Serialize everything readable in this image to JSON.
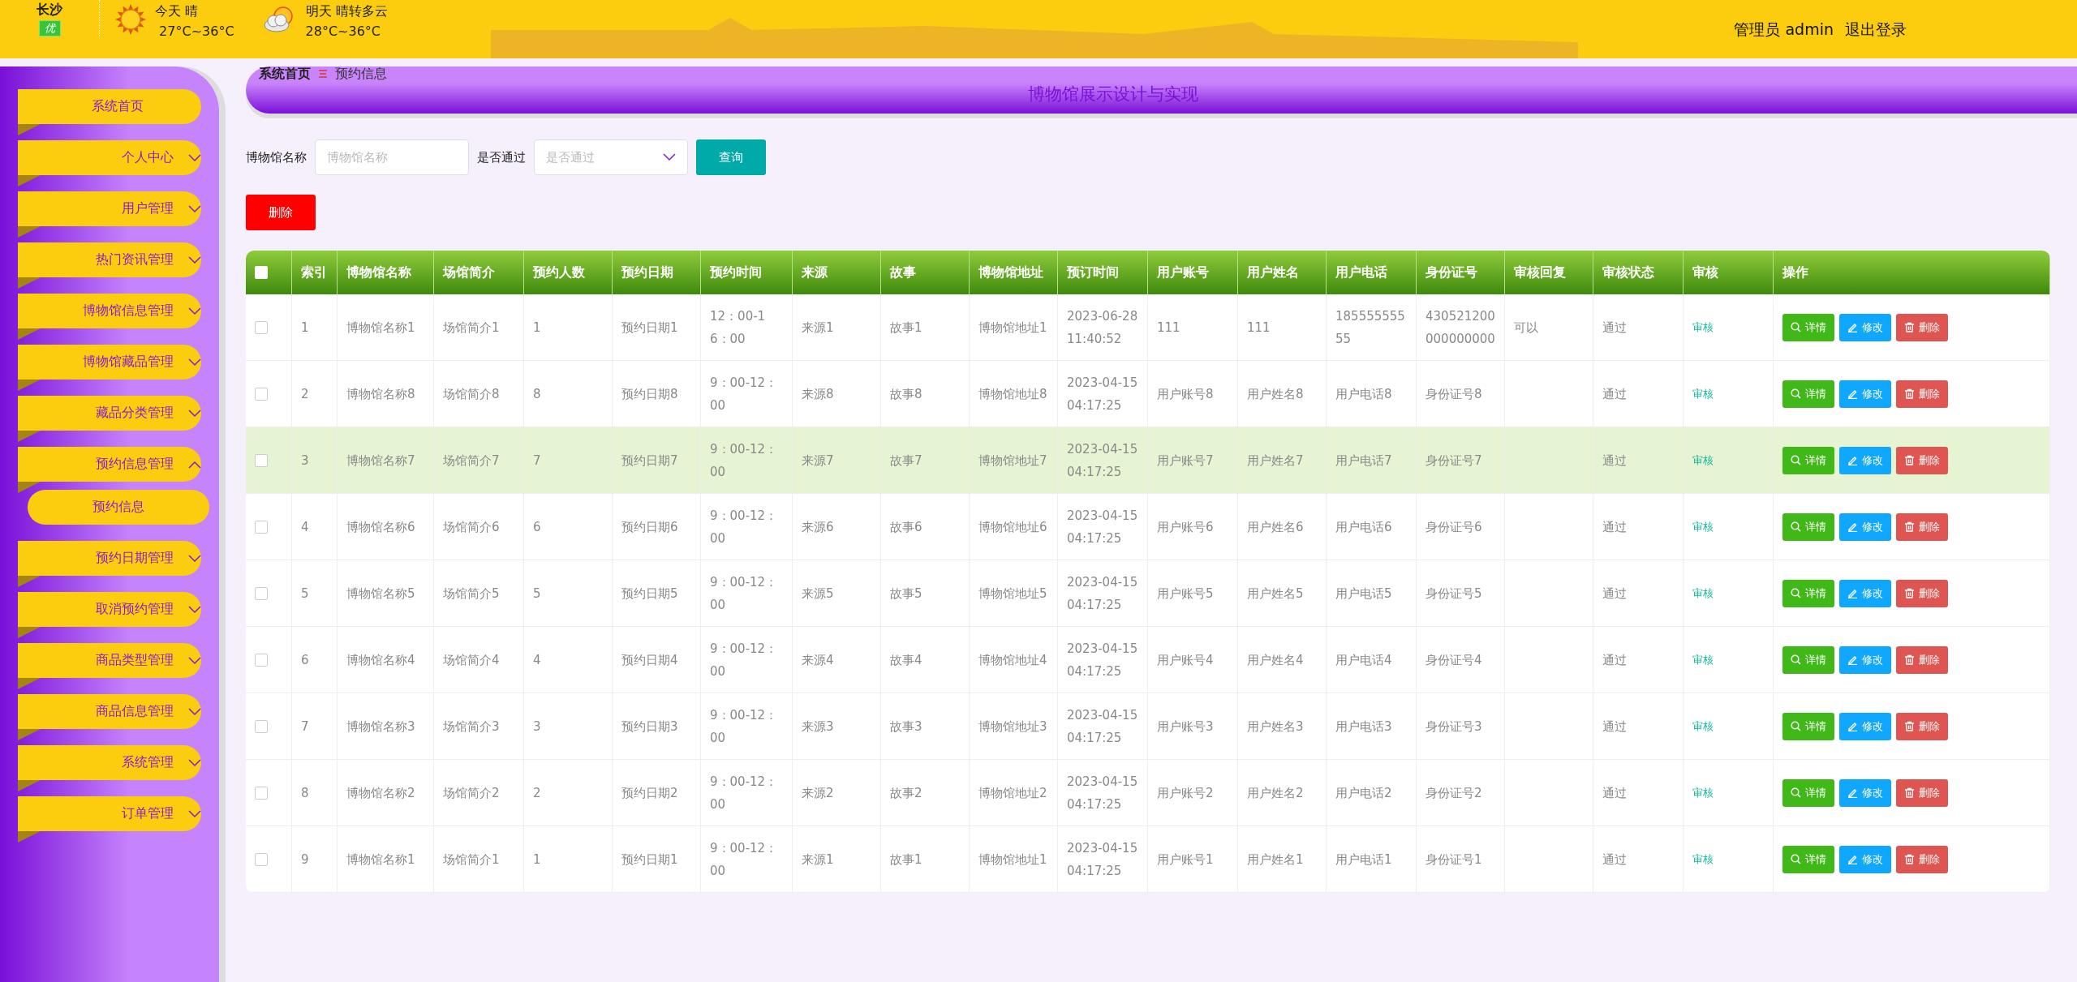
{
  "header": {
    "city": "长沙",
    "air_quality": "优",
    "today": {
      "label": "今天",
      "weather": "晴",
      "temp": "27°C~36°C"
    },
    "tomorrow": {
      "label": "明天",
      "weather": "晴转多云",
      "temp": "28°C~36°C"
    },
    "user": "管理员 admin",
    "logout": "退出登录"
  },
  "sidebar": {
    "items": [
      {
        "label": "系统首页",
        "kind": "link"
      },
      {
        "label": "个人中心",
        "kind": "menu",
        "expanded": false
      },
      {
        "label": "用户管理",
        "kind": "menu",
        "expanded": false
      },
      {
        "label": "热门资讯管理",
        "kind": "menu",
        "expanded": false
      },
      {
        "label": "博物馆信息管理",
        "kind": "menu",
        "expanded": false
      },
      {
        "label": "博物馆藏品管理",
        "kind": "menu",
        "expanded": false
      },
      {
        "label": "藏品分类管理",
        "kind": "menu",
        "expanded": false
      },
      {
        "label": "预约信息管理",
        "kind": "menu",
        "expanded": true,
        "children": [
          {
            "label": "预约信息"
          }
        ]
      },
      {
        "label": "预约日期管理",
        "kind": "menu",
        "expanded": false
      },
      {
        "label": "取消预约管理",
        "kind": "menu",
        "expanded": false
      },
      {
        "label": "商品类型管理",
        "kind": "menu",
        "expanded": false
      },
      {
        "label": "商品信息管理",
        "kind": "menu",
        "expanded": false
      },
      {
        "label": "系统管理",
        "kind": "menu",
        "expanded": false
      },
      {
        "label": "订单管理",
        "kind": "menu",
        "expanded": false
      }
    ]
  },
  "breadcrumb": [
    "系统首页",
    "预约信息"
  ],
  "page_title": "博物馆展示设计与实现",
  "search": {
    "fields": [
      {
        "label": "博物馆名称",
        "kind": "text",
        "placeholder": "博物馆名称"
      },
      {
        "label": "是否通过",
        "kind": "select",
        "placeholder": "是否通过"
      }
    ],
    "button": "查询"
  },
  "delete_button": "删除",
  "table": {
    "select_all": false,
    "columns": [
      "索引",
      "博物馆名称",
      "场馆简介",
      "预约人数",
      "预约日期",
      "预约时间",
      "来源",
      "故事",
      "博物馆地址",
      "预订时间",
      "用户账号",
      "用户姓名",
      "用户电话",
      "身份证号",
      "审核回复",
      "审核状态",
      "审核",
      "操作"
    ],
    "rows": [
      {
        "checked": false,
        "highlighted": false,
        "cells": [
          "1",
          "博物馆名称1",
          "场馆简介1",
          "1",
          "预约日期1",
          "12：00-16：00",
          "来源1",
          "故事1",
          "博物馆地址1",
          "2023-06-28 11:40:52",
          "111",
          "111",
          "18555555555",
          "430521200000000000"
        ],
        "reply": "可以",
        "status": "通过",
        "review": "审核",
        "actions": [
          "详情",
          "修改",
          "删除"
        ]
      },
      {
        "checked": false,
        "highlighted": false,
        "cells": [
          "2",
          "博物馆名称8",
          "场馆简介8",
          "8",
          "预约日期8",
          "9：00-12：00",
          "来源8",
          "故事8",
          "博物馆地址8",
          "2023-04-15 04:17:25",
          "用户账号8",
          "用户姓名8",
          "用户电话8",
          "身份证号8"
        ],
        "status": "通过",
        "review": "审核",
        "actions": [
          "详情",
          "修改",
          "删除"
        ]
      },
      {
        "checked": false,
        "highlighted": true,
        "cells": [
          "3",
          "博物馆名称7",
          "场馆简介7",
          "7",
          "预约日期7",
          "9：00-12：00",
          "来源7",
          "故事7",
          "博物馆地址7",
          "2023-04-15 04:17:25",
          "用户账号7",
          "用户姓名7",
          "用户电话7",
          "身份证号7"
        ],
        "status": "通过",
        "review": "审核",
        "actions": [
          "详情",
          "修改",
          "删除"
        ]
      },
      {
        "checked": false,
        "highlighted": false,
        "cells": [
          "4",
          "博物馆名称6",
          "场馆简介6",
          "6",
          "预约日期6",
          "9：00-12：00",
          "来源6",
          "故事6",
          "博物馆地址6",
          "2023-04-15 04:17:25",
          "用户账号6",
          "用户姓名6",
          "用户电话6",
          "身份证号6"
        ],
        "status": "通过",
        "review": "审核",
        "actions": [
          "详情",
          "修改",
          "删除"
        ]
      },
      {
        "checked": false,
        "highlighted": false,
        "cells": [
          "5",
          "博物馆名称5",
          "场馆简介5",
          "5",
          "预约日期5",
          "9：00-12：00",
          "来源5",
          "故事5",
          "博物馆地址5",
          "2023-04-15 04:17:25",
          "用户账号5",
          "用户姓名5",
          "用户电话5",
          "身份证号5"
        ],
        "status": "通过",
        "review": "审核",
        "actions": [
          "详情",
          "修改",
          "删除"
        ]
      },
      {
        "checked": false,
        "highlighted": false,
        "cells": [
          "6",
          "博物馆名称4",
          "场馆简介4",
          "4",
          "预约日期4",
          "9：00-12：00",
          "来源4",
          "故事4",
          "博物馆地址4",
          "2023-04-15 04:17:25",
          "用户账号4",
          "用户姓名4",
          "用户电话4",
          "身份证号4"
        ],
        "status": "通过",
        "review": "审核",
        "actions": [
          "详情",
          "修改",
          "删除"
        ]
      },
      {
        "checked": false,
        "highlighted": false,
        "cells": [
          "7",
          "博物馆名称3",
          "场馆简介3",
          "3",
          "预约日期3",
          "9：00-12：00",
          "来源3",
          "故事3",
          "博物馆地址3",
          "2023-04-15 04:17:25",
          "用户账号3",
          "用户姓名3",
          "用户电话3",
          "身份证号3"
        ],
        "status": "通过",
        "review": "审核",
        "actions": [
          "详情",
          "修改",
          "删除"
        ]
      },
      {
        "checked": false,
        "highlighted": false,
        "cells": [
          "8",
          "博物馆名称2",
          "场馆简介2",
          "2",
          "预约日期2",
          "9：00-12：00",
          "来源2",
          "故事2",
          "博物馆地址2",
          "2023-04-15 04:17:25",
          "用户账号2",
          "用户姓名2",
          "用户电话2",
          "身份证号2"
        ],
        "status": "通过",
        "review": "审核",
        "actions": [
          "详情",
          "修改",
          "删除"
        ]
      },
      {
        "checked": false,
        "highlighted": false,
        "cells": [
          "9",
          "博物馆名称1",
          "场馆简介1",
          "1",
          "预约日期1",
          "9：00-12：00",
          "来源1",
          "故事1",
          "博物馆地址1",
          "2023-04-15 04:17:25",
          "用户账号1",
          "用户姓名1",
          "用户电话1",
          "身份证号1"
        ],
        "status": "通过",
        "review": "审核",
        "actions": [
          "详情",
          "修改",
          "删除"
        ]
      }
    ]
  }
}
